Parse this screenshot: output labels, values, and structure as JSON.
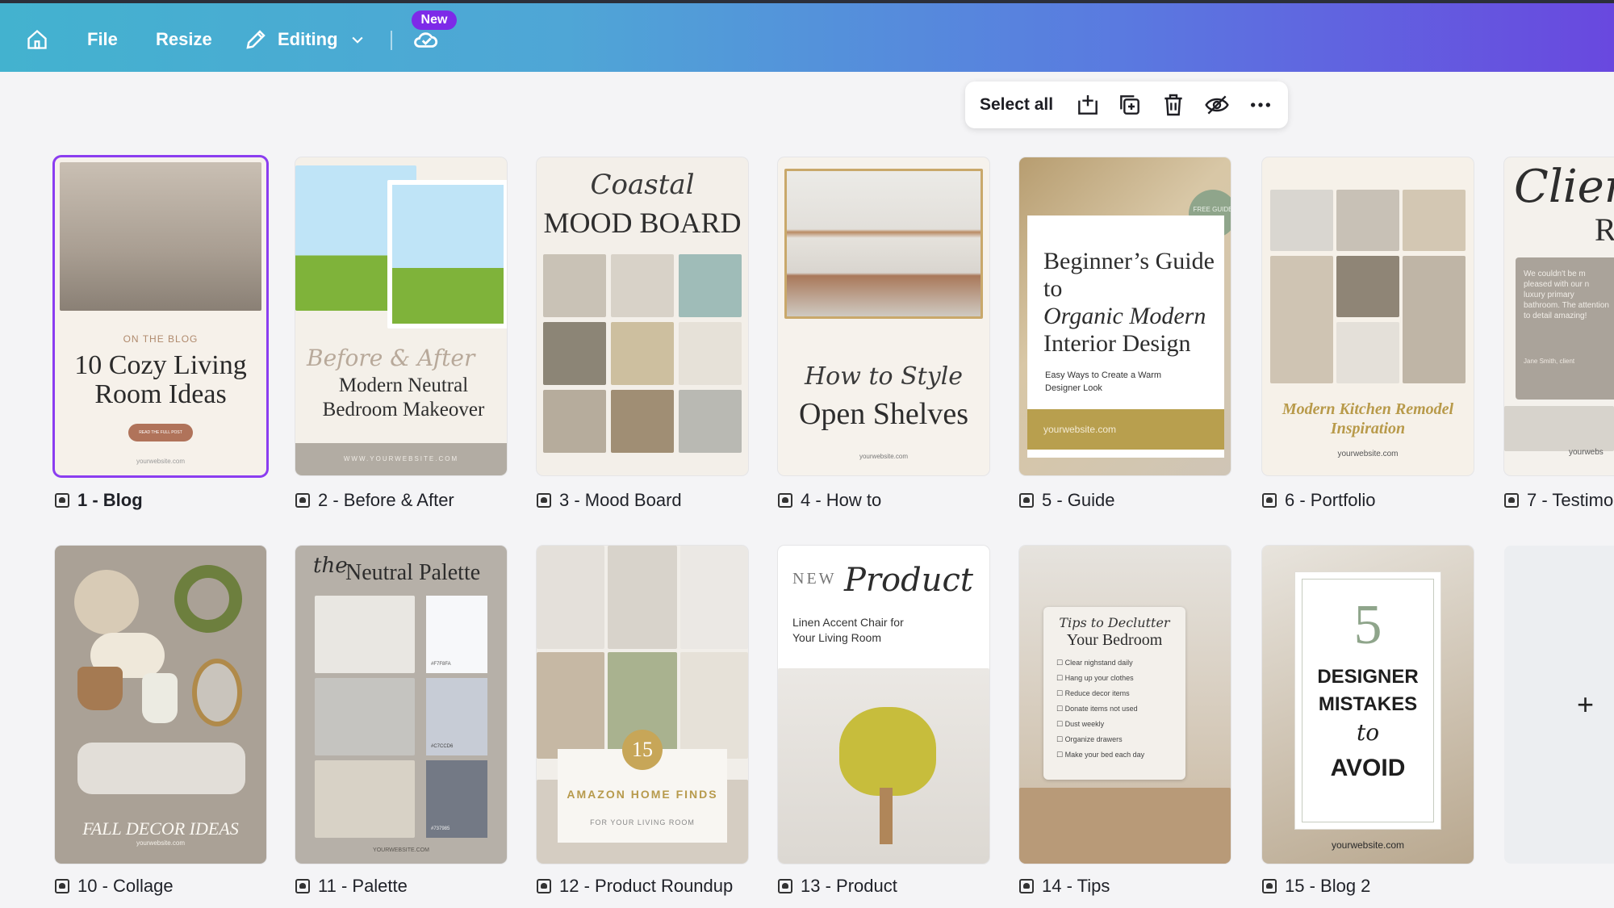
{
  "topbar": {
    "file_label": "File",
    "resize_label": "Resize",
    "editing_label": "Editing",
    "new_badge": "New",
    "icons": [
      "home-icon",
      "pencil-icon",
      "chevron-down-icon",
      "check-cloud-icon"
    ]
  },
  "toolbar": {
    "select_all_label": "Select all",
    "icons": [
      "add-page-icon",
      "duplicate-icon",
      "trash-icon",
      "hide-icon",
      "more-icon"
    ]
  },
  "pages": [
    {
      "label": "1 - Blog",
      "eyebrow": "ON THE BLOG",
      "title": "10 Cozy Living Room Ideas",
      "cta": "READ THE FULL POST",
      "footer": "yourwebsite.com"
    },
    {
      "label": "2 - Before & After",
      "script": "Before & After",
      "title": "Modern Neutral Bedroom Makeover",
      "footer": "WWW.YOURWEBSITE.COM"
    },
    {
      "label": "3 - Mood Board",
      "script": "Coastal",
      "title": "MOOD BOARD"
    },
    {
      "label": "4 - How to",
      "script": "How to Style",
      "title": "Open Shelves",
      "footer": "yourwebsite.com"
    },
    {
      "label": "5 - Guide",
      "badge": "FREE GUIDE",
      "title_a": "Beginner’s Guide to",
      "title_b": "Organic Modern",
      "title_c": "Interior Design",
      "sub": "Easy Ways to Create a Warm Designer Look",
      "footer": "yourwebsite.com"
    },
    {
      "label": "6 - Portfolio",
      "title": "Modern Kitchen Remodel Inspiration",
      "footer": "yourwebsite.com"
    },
    {
      "label": "7 - Testimo",
      "script": "Client",
      "title": "R",
      "quote": "We couldn't be m pleased with our n luxury primary bathroom. The attention to detail amazing!",
      "author": "Jane Smith, client",
      "footer": "yourwebs"
    },
    {
      "label": "10 - Collage",
      "title": "FALL DECOR IDEAS",
      "footer": "yourwebsite.com"
    },
    {
      "label": "11 - Palette",
      "script": "the",
      "title": "Neutral Palette",
      "swatches": [
        "#F7F8FA",
        "#C7CCD6",
        "#737985"
      ],
      "footer": "YOURWEBSITE.COM"
    },
    {
      "label": "12 - Product Roundup",
      "number": "15",
      "title": "AMAZON HOME FINDS",
      "sub": "FOR YOUR LIVING ROOM"
    },
    {
      "label": "13 - Product",
      "eyebrow": "NEW",
      "script": "Product",
      "sub": "Linen Accent Chair for Your Living Room"
    },
    {
      "label": "14 - Tips",
      "script": "Tips to Declutter",
      "title": "Your Bedroom",
      "items": [
        "Clear nighstand daily",
        "Hang up your clothes",
        "Reduce decor items",
        "Donate items not used",
        "Dust weekly",
        "Organize drawers",
        "Make your bed each day"
      ]
    },
    {
      "label": "15 - Blog 2",
      "number": "5",
      "title_a": "DESIGNER",
      "title_b": "MISTAKES",
      "script": "to",
      "title_c": "AVOID",
      "footer": "yourwebsite.com"
    }
  ],
  "add_page_symbol": "+",
  "colors": {
    "selection": "#8b3df0",
    "badge": "#7d2ae8",
    "gold": "#b89a4a"
  }
}
